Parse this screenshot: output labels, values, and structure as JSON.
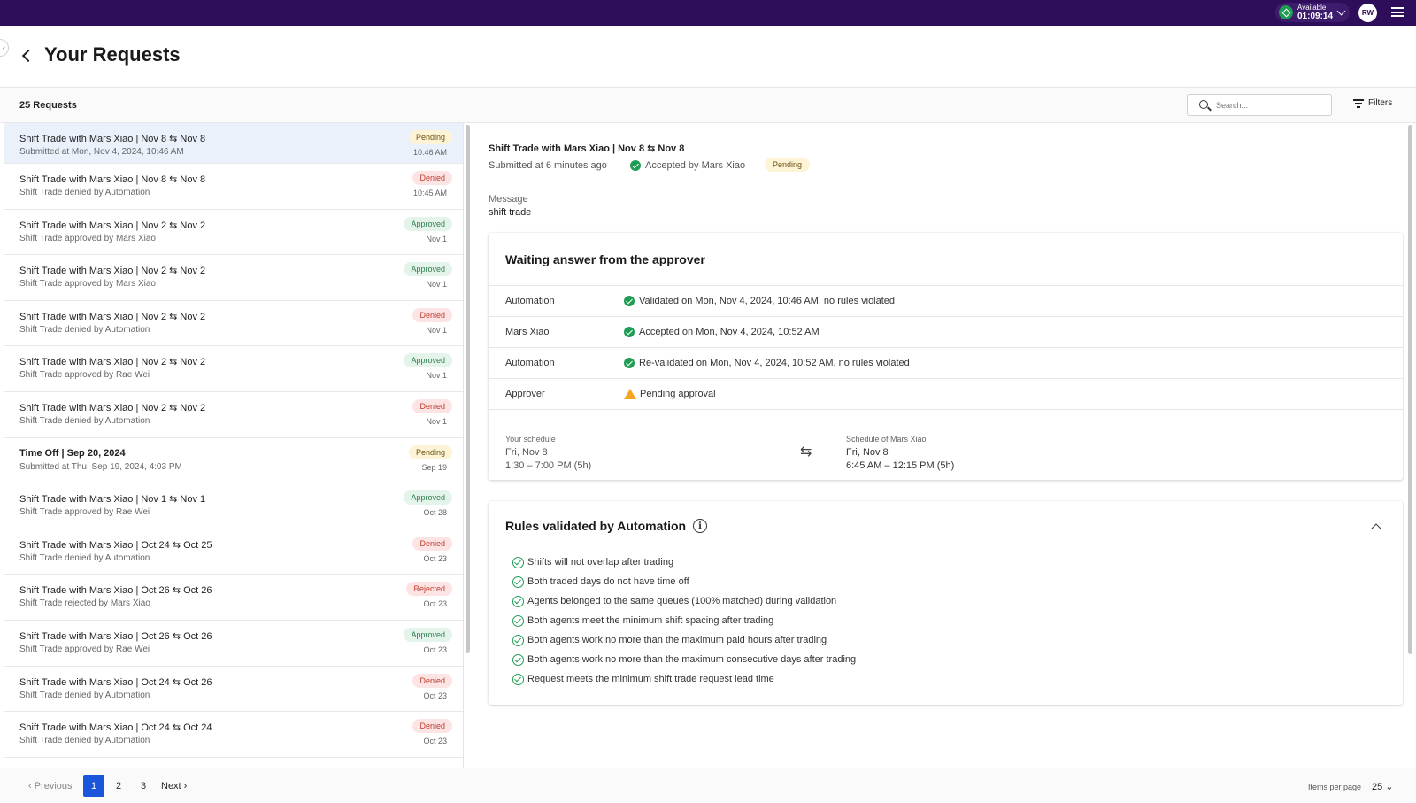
{
  "topbar": {
    "status_label": "Available",
    "status_timer": "01:09:14",
    "avatar_initials": "RW"
  },
  "header": {
    "title": "Your Requests"
  },
  "toolbar": {
    "count": "25 Requests",
    "search_placeholder": "Search...",
    "filters_label": "Filters"
  },
  "list": [
    {
      "title": "Shift Trade with Mars Xiao | Nov 8 ⇆ Nov 8",
      "subtitle": "Submitted at Mon, Nov 4, 2024, 10:46 AM",
      "status": "Pending",
      "date": "10:46 AM",
      "bold": false,
      "selected": true
    },
    {
      "title": "Shift Trade with Mars Xiao | Nov 8 ⇆ Nov 8",
      "subtitle": "Shift Trade denied by Automation",
      "status": "Denied",
      "date": "10:45 AM",
      "bold": false,
      "selected": false
    },
    {
      "title": "Shift Trade with Mars Xiao | Nov 2 ⇆ Nov 2",
      "subtitle": "Shift Trade approved by Mars Xiao",
      "status": "Approved",
      "date": "Nov 1",
      "bold": false,
      "selected": false
    },
    {
      "title": "Shift Trade with Mars Xiao | Nov 2 ⇆ Nov 2",
      "subtitle": "Shift Trade approved by Mars Xiao",
      "status": "Approved",
      "date": "Nov 1",
      "bold": false,
      "selected": false
    },
    {
      "title": "Shift Trade with Mars Xiao | Nov 2 ⇆ Nov 2",
      "subtitle": "Shift Trade denied by Automation",
      "status": "Denied",
      "date": "Nov 1",
      "bold": false,
      "selected": false
    },
    {
      "title": "Shift Trade with Mars Xiao | Nov 2 ⇆ Nov 2",
      "subtitle": "Shift Trade approved by Rae Wei",
      "status": "Approved",
      "date": "Nov 1",
      "bold": false,
      "selected": false
    },
    {
      "title": "Shift Trade with Mars Xiao | Nov 2 ⇆ Nov 2",
      "subtitle": "Shift Trade denied by Automation",
      "status": "Denied",
      "date": "Nov 1",
      "bold": false,
      "selected": false
    },
    {
      "title": "Time Off | Sep 20, 2024",
      "subtitle": "Submitted at Thu, Sep 19, 2024, 4:03 PM",
      "status": "Pending",
      "date": "Sep 19",
      "bold": true,
      "selected": false
    },
    {
      "title": "Shift Trade with Mars Xiao | Nov 1 ⇆ Nov 1",
      "subtitle": "Shift Trade approved by Rae Wei",
      "status": "Approved",
      "date": "Oct 28",
      "bold": false,
      "selected": false
    },
    {
      "title": "Shift Trade with Mars Xiao | Oct 24 ⇆ Oct 25",
      "subtitle": "Shift Trade denied by Automation",
      "status": "Denied",
      "date": "Oct 23",
      "bold": false,
      "selected": false
    },
    {
      "title": "Shift Trade with Mars Xiao | Oct 26 ⇆ Oct 26",
      "subtitle": "Shift Trade rejected by Mars Xiao",
      "status": "Rejected",
      "date": "Oct 23",
      "bold": false,
      "selected": false
    },
    {
      "title": "Shift Trade with Mars Xiao | Oct 26 ⇆ Oct 26",
      "subtitle": "Shift Trade approved by Rae Wei",
      "status": "Approved",
      "date": "Oct 23",
      "bold": false,
      "selected": false
    },
    {
      "title": "Shift Trade with Mars Xiao | Oct 24 ⇆ Oct 26",
      "subtitle": "Shift Trade denied by Automation",
      "status": "Denied",
      "date": "Oct 23",
      "bold": false,
      "selected": false
    },
    {
      "title": "Shift Trade with Mars Xiao | Oct 24 ⇆ Oct 24",
      "subtitle": "Shift Trade denied by Automation",
      "status": "Denied",
      "date": "Oct 23",
      "bold": false,
      "selected": false
    }
  ],
  "pagination": {
    "prev_label": "Previous",
    "pages": [
      "1",
      "2",
      "3"
    ],
    "next_label": "Next",
    "items_per_page_label": "Items per page",
    "items_per_page_value": "25"
  },
  "detail": {
    "title": "Shift Trade with Mars Xiao | Nov 8 ⇆ Nov 8",
    "submitted": "Submitted at 6 minutes ago",
    "accepted": "Accepted by Mars Xiao",
    "status": "Pending",
    "message_label": "Message",
    "message": "shift trade",
    "approval_card": {
      "title": "Waiting answer from the approver",
      "rows": [
        {
          "name": "Automation",
          "text": "Validated on Mon, Nov 4, 2024, 10:46 AM, no rules violated",
          "icon": "check"
        },
        {
          "name": "Mars Xiao",
          "text": "Accepted on Mon, Nov 4, 2024, 10:52 AM",
          "icon": "check"
        },
        {
          "name": "Automation",
          "text": "Re-validated on Mon, Nov 4, 2024, 10:52 AM, no rules violated",
          "icon": "check"
        },
        {
          "name": "Approver",
          "text": "Pending approval",
          "icon": "warning"
        }
      ],
      "your_schedule_label": "Your schedule",
      "your_schedule_day": "Fri, Nov 8",
      "your_schedule_time": "1:30 – 7:00 PM (5h)",
      "other_schedule_label": "Schedule of Mars Xiao",
      "other_schedule_day": "Fri, Nov 8",
      "other_schedule_time": "6:45 AM – 12:15 PM (5h)"
    },
    "rules_card": {
      "title": "Rules validated by Automation",
      "rules": [
        "Shifts will not overlap after trading",
        "Both traded days do not have time off",
        "Agents belonged to the same queues (100% matched) during validation",
        "Both agents meet the minimum shift spacing after trading",
        "Both agents work no more than the maximum paid hours after trading",
        "Both agents work no more than the maximum consecutive days after trading",
        "Request meets the minimum shift trade request lead time"
      ]
    }
  }
}
